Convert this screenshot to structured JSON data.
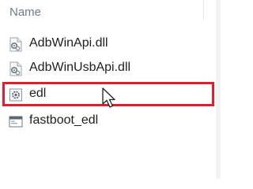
{
  "header": {
    "column_name": "Name"
  },
  "files": [
    {
      "name": "AdbWinApi.dll",
      "icon": "dll-gear-file-icon"
    },
    {
      "name": "AdbWinUsbApi.dll",
      "icon": "dll-gear-file-icon"
    },
    {
      "name": "edl",
      "icon": "settings-file-icon",
      "highlighted": true
    },
    {
      "name": "fastboot_edl",
      "icon": "application-window-icon"
    }
  ],
  "colors": {
    "highlight": "#e01f2d",
    "header_text": "#6d7b8d"
  }
}
